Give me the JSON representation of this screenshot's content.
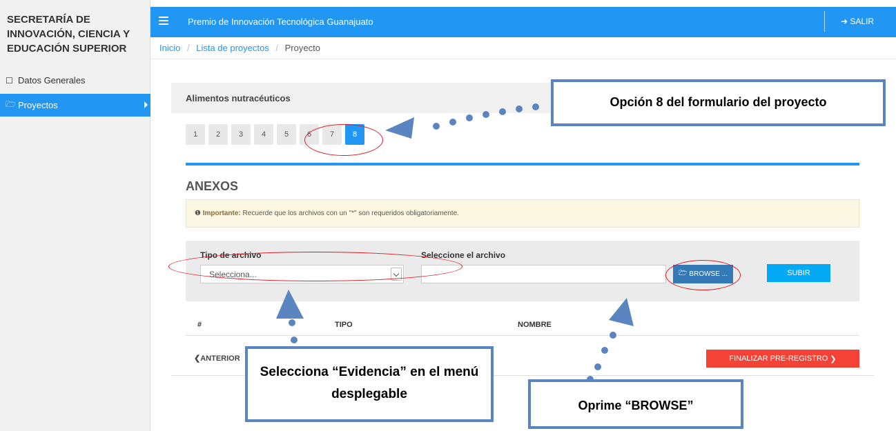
{
  "sidebar": {
    "org_title": "SECRETARÍA DE INNOVACIÓN, CIENCIA Y EDUCACIÓN SUPERIOR",
    "items": [
      {
        "label": "Datos Generales",
        "icon": "square-icon"
      },
      {
        "label": "Proyectos",
        "icon": "folder-open-icon",
        "active": true
      }
    ]
  },
  "header": {
    "app_title": "Premio de Innovación Tecnológica Guanajuato",
    "logout_label": "SALIR",
    "accent": "#2196f3"
  },
  "breadcrumb": {
    "items": [
      "Inicio",
      "Lista de proyectos",
      "Proyecto"
    ],
    "separator": "/"
  },
  "panel": {
    "project_name": "Alimentos nutracéuticos",
    "steps": [
      "1",
      "2",
      "3",
      "4",
      "5",
      "6",
      "7",
      "8"
    ],
    "active_step": "8",
    "section_title": "ANEXOS",
    "alert": {
      "strong": "Importante:",
      "text": "Recuerde que los archivos con un \"*\" son requeridos obligatoriamente."
    },
    "upload": {
      "type_label": "Tipo de archivo",
      "type_value": "Selecciona...",
      "file_label": "Seleccione el archivo",
      "file_value": "",
      "browse_label": "BROWSE ...",
      "upload_label": "SUBIR"
    },
    "table": {
      "columns": [
        "#",
        "TIPO",
        "NOMBRE"
      ],
      "rows": []
    },
    "prev_label": "ANTERIOR",
    "finish_label": "FINALIZAR PRE-REGISTRO"
  },
  "annotations": {
    "callout_step": "Opción 8 del formulario del proyecto",
    "callout_select": "Selecciona “Evidencia” en el menú desplegable",
    "callout_browse": "Oprime “BROWSE”",
    "arrow_color": "#5b85c0",
    "circle_color": "#e01b24"
  }
}
